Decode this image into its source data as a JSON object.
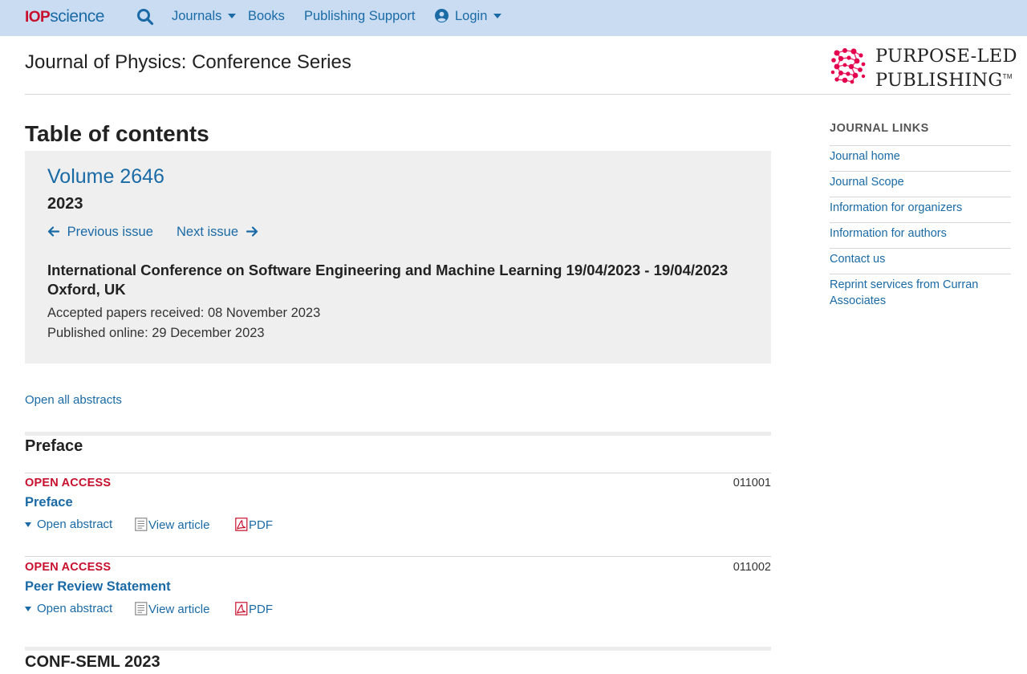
{
  "nav": {
    "logo_iop": "IOP",
    "logo_science": "science",
    "search_icon": "search-icon",
    "journals": "Journals",
    "books": "Books",
    "publishing_support": "Publishing Support",
    "login": "Login",
    "user_icon": "user-circle-icon",
    "bar_color": "#c9dcf2",
    "link_color": "#1a6aa6"
  },
  "header": {
    "journal_title": "Journal of Physics: Conference Series",
    "publisher_line1": "PURPOSE-LED",
    "publisher_line2": "PUBLISHING",
    "publisher_tm": "TM",
    "publisher_mark_color": "#e4004f"
  },
  "main": {
    "toc_heading": "Table of contents",
    "volume": "Volume 2646",
    "year": "2023",
    "previous_issue": "Previous issue",
    "next_issue": "Next issue",
    "conference": "International Conference on Software Engineering and Machine Learning 19/04/2023 - 19/04/2023 Oxford, UK",
    "accepted": "Accepted papers received: 08 November 2023",
    "published": "Published online: 29 December 2023",
    "open_all_abstracts": "Open all abstracts"
  },
  "sections": [
    {
      "title": "Preface",
      "articles": [
        {
          "access": "OPEN ACCESS",
          "number": "011001",
          "title": "Preface",
          "open_abstract": "Open abstract",
          "view_article": "View article",
          "pdf": "PDF"
        },
        {
          "access": "OPEN ACCESS",
          "number": "011002",
          "title": "Peer Review Statement",
          "open_abstract": "Open abstract",
          "view_article": "View article",
          "pdf": "PDF"
        }
      ]
    },
    {
      "title": "CONF-SEML 2023",
      "articles": []
    }
  ],
  "sidebar": {
    "heading": "JOURNAL LINKS",
    "links": [
      "Journal home",
      "Journal Scope",
      "Information for organizers",
      "Information for authors",
      "Contact us",
      "Reprint services from Curran Associates"
    ]
  },
  "colors": {
    "open_access": "#c8102e",
    "issue_box_bg": "#efefef"
  }
}
